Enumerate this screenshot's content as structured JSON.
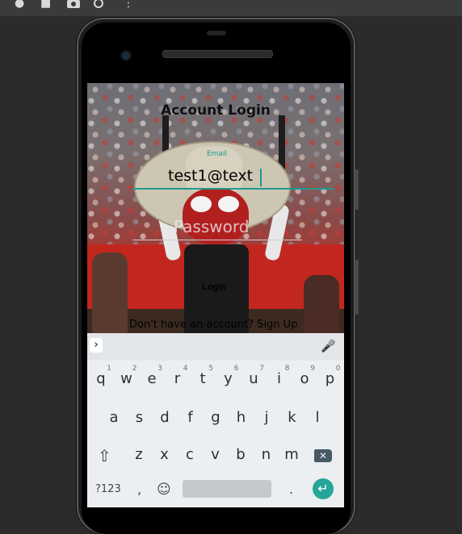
{
  "emulator_toolbar": {
    "icons": [
      "record-icon",
      "stop-icon",
      "camera-icon",
      "rotate-icon",
      "more-icon"
    ]
  },
  "app": {
    "title": "Account Login",
    "email": {
      "label": "Email",
      "value": "test1@text"
    },
    "password": {
      "placeholder": "Password"
    },
    "login_button": "Login",
    "signup_text": "Don't have an account? Sign Up"
  },
  "keyboard": {
    "row1": [
      "q",
      "w",
      "e",
      "r",
      "t",
      "y",
      "u",
      "i",
      "o",
      "p"
    ],
    "row1_hints": [
      "1",
      "2",
      "3",
      "4",
      "5",
      "6",
      "7",
      "8",
      "9",
      "0"
    ],
    "row2": [
      "a",
      "s",
      "d",
      "f",
      "g",
      "h",
      "j",
      "k",
      "l"
    ],
    "row3": [
      "z",
      "x",
      "c",
      "v",
      "b",
      "n",
      "m"
    ],
    "numbers_key": "?123",
    "comma_key": ",",
    "period_key": ".",
    "colors": {
      "enter": "#26a69a",
      "accent": "#1e9a8f"
    }
  }
}
